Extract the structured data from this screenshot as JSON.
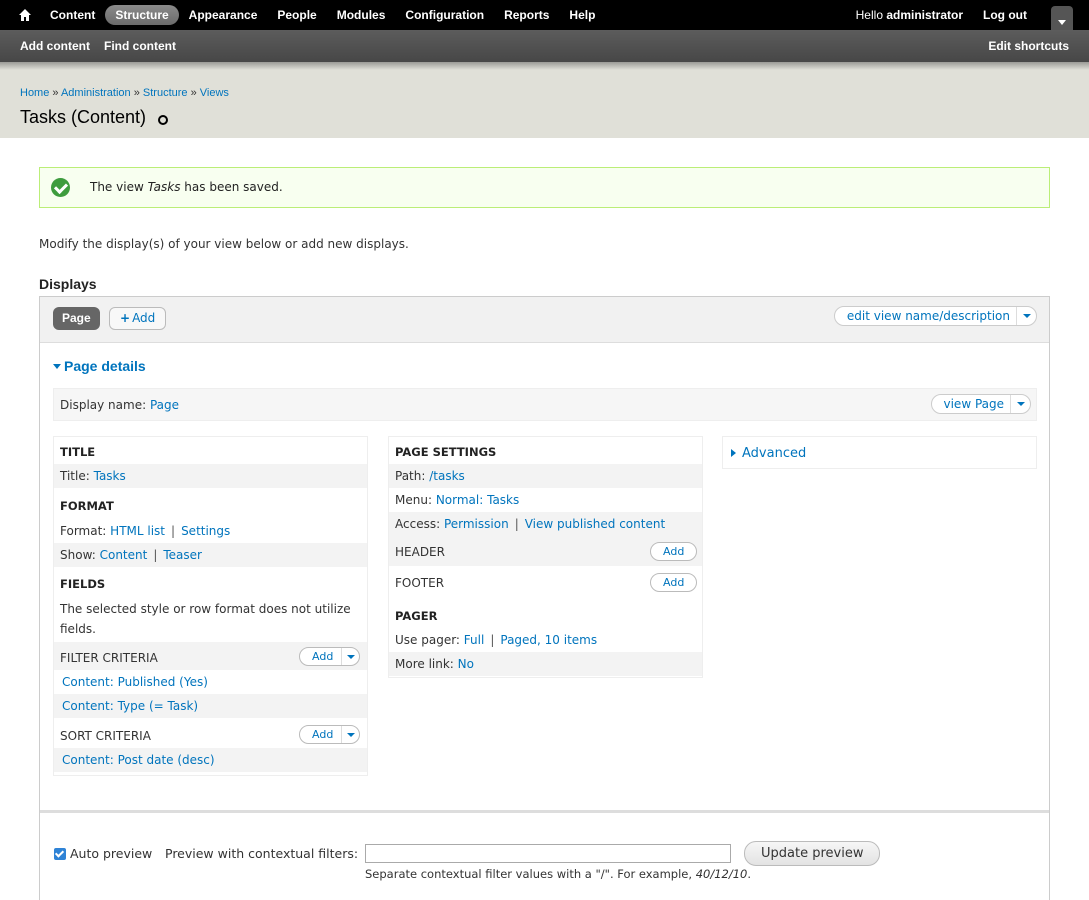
{
  "toolbar": {
    "menu": [
      "Content",
      "Structure",
      "Appearance",
      "People",
      "Modules",
      "Configuration",
      "Reports",
      "Help"
    ],
    "active": "Structure",
    "hello_prefix": "Hello ",
    "user": "administrator",
    "logout": "Log out"
  },
  "shortcuts": {
    "items": [
      "Add content",
      "Find content"
    ],
    "edit": "Edit shortcuts"
  },
  "breadcrumb": [
    "Home",
    "Administration",
    "Structure",
    "Views"
  ],
  "breadcrumb_sep": " » ",
  "page_title": "Tasks (Content)",
  "status": {
    "prefix": "The view ",
    "view_name": "Tasks",
    "suffix": " has been saved."
  },
  "intro": "Modify the display(s) of your view below or add new displays.",
  "displays_title": "Displays",
  "tabs": {
    "page": "Page",
    "add_plus": "+",
    "add": "Add",
    "edit_view": "edit view name/description"
  },
  "page_details": {
    "toggle": "Page details",
    "display_name_label": "Display name:",
    "display_name_value": "Page",
    "view_page": "view Page"
  },
  "col1": {
    "title_head": "TITLE",
    "title_label": "Title:",
    "title_value": "Tasks",
    "format_head": "FORMAT",
    "format_label": "Format:",
    "format_value": "HTML list",
    "format_settings": "Settings",
    "show_label": "Show:",
    "show_value": "Content",
    "show_teaser": "Teaser",
    "fields_head": "FIELDS",
    "fields_note_1": "The selected style or row format does not utilize",
    "fields_note_2": "fields.",
    "filter_head": "FILTER CRITERIA",
    "filter_add": "Add",
    "filter_1": "Content: Published (Yes)",
    "filter_2": "Content: Type (= Task)",
    "sort_head": "SORT CRITERIA",
    "sort_add": "Add",
    "sort_1": "Content: Post date (desc)"
  },
  "col2": {
    "page_settings_head": "PAGE SETTINGS",
    "path_label": "Path:",
    "path_value": "/tasks",
    "menu_label": "Menu:",
    "menu_value": "Normal: Tasks",
    "access_label": "Access:",
    "access_value": "Permission",
    "access_perm": "View published content",
    "header_head": "HEADER",
    "header_add": "Add",
    "footer_head": "FOOTER",
    "footer_add": "Add",
    "pager_head": "PAGER",
    "pager_label": "Use pager:",
    "pager_value": "Full",
    "pager_items": "Paged, 10 items",
    "more_label": "More link:",
    "more_value": "No"
  },
  "col3": {
    "advanced": "Advanced"
  },
  "preview": {
    "auto_preview_label": "Auto preview",
    "auto_preview_checked": true,
    "ctx_label": "Preview with contextual filters:",
    "ctx_value": "",
    "update_button": "Update preview",
    "ctx_desc_prefix": "Separate contextual filter values with a \"/\". For example, ",
    "ctx_desc_example": "40/12/10",
    "ctx_desc_suffix": "."
  },
  "colors": {
    "link": "#0074bd",
    "status_bg": "#f8fff0",
    "status_border": "#bbee77",
    "header_bg": "#e0e0d8"
  },
  "icons": [
    "home-icon",
    "toolbar-toggle-icon",
    "add-shortcut-icon",
    "success-check-icon",
    "caret-down-icon",
    "triangle-right-icon",
    "checkbox-checked-icon"
  ]
}
